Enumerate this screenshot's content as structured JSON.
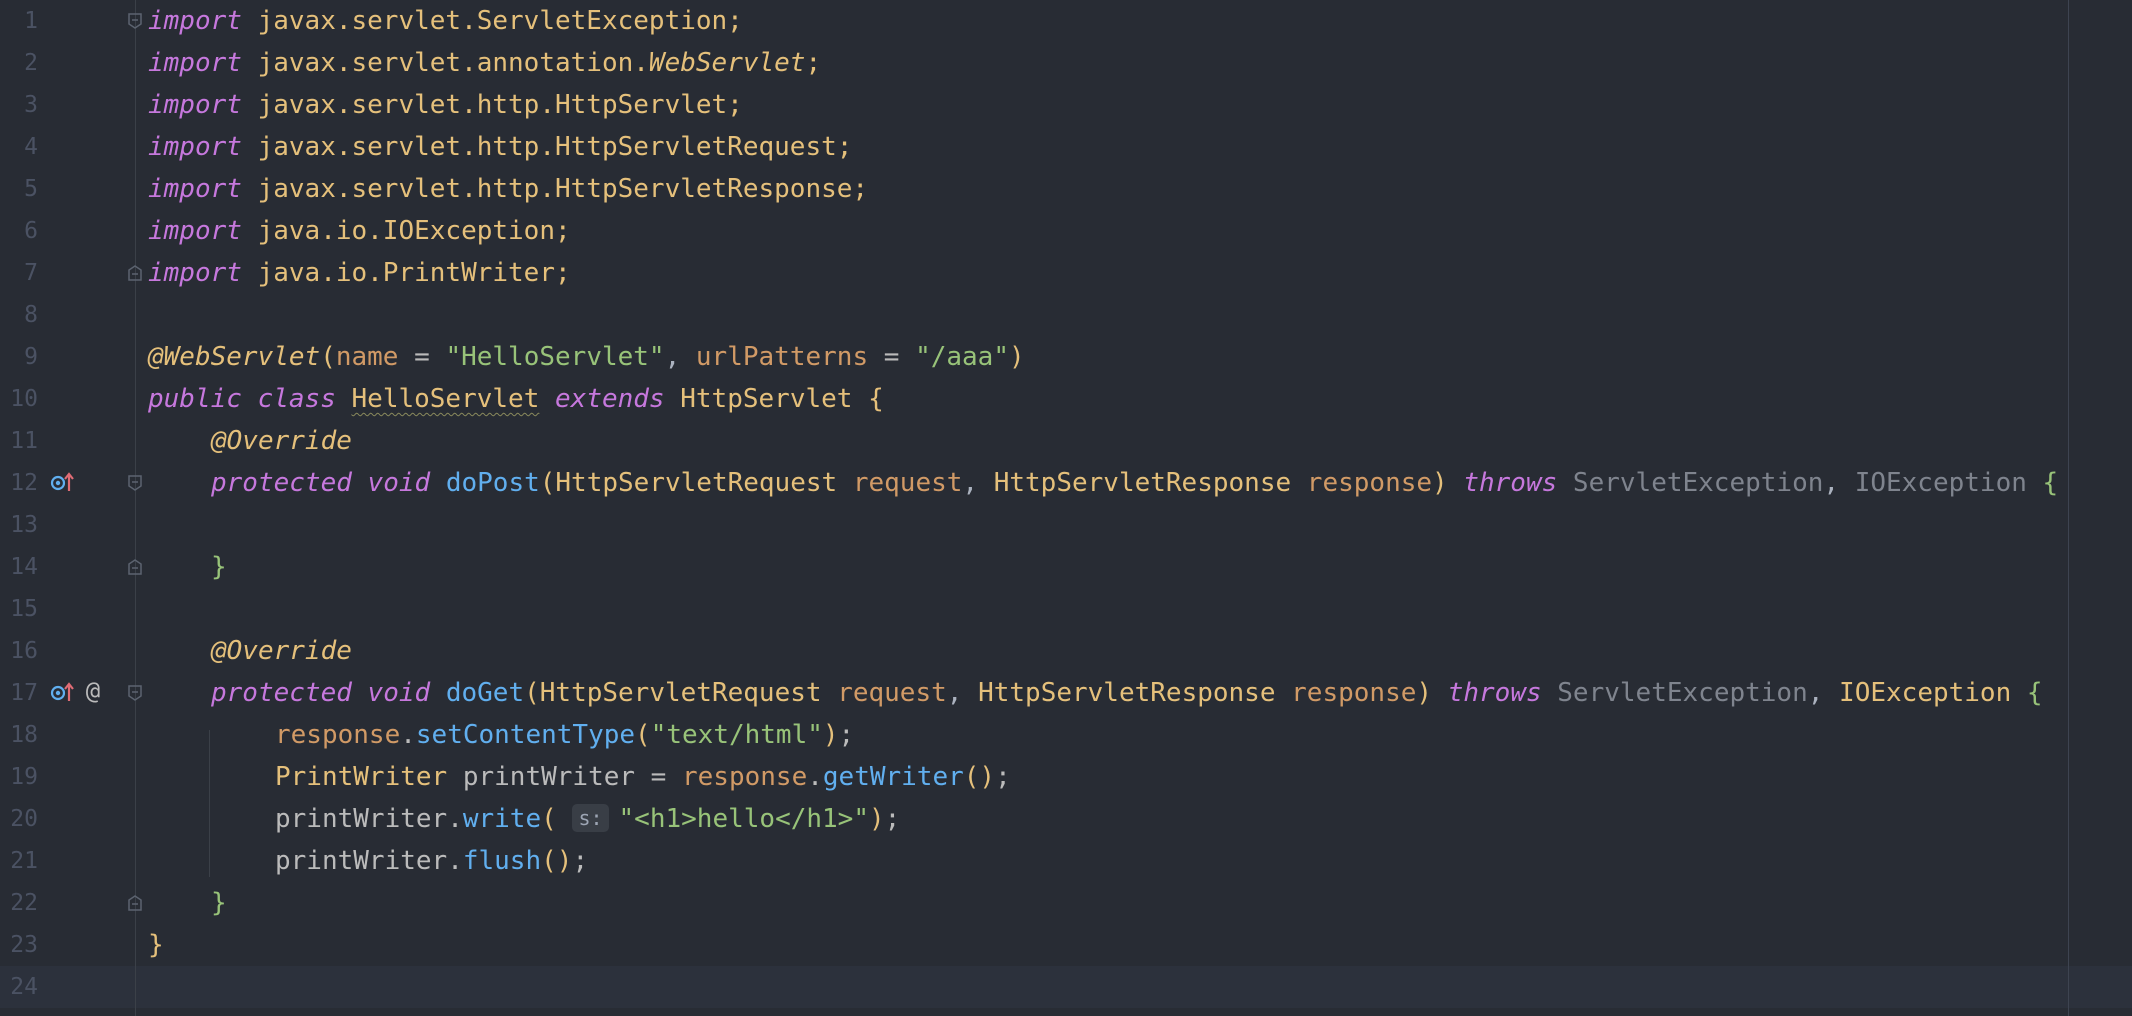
{
  "line_numbers": [
    "1",
    "2",
    "3",
    "4",
    "5",
    "6",
    "7",
    "8",
    "9",
    "10",
    "11",
    "12",
    "13",
    "14",
    "15",
    "16",
    "17",
    "18",
    "19",
    "20",
    "21",
    "22",
    "23",
    "24"
  ],
  "gutter": {
    "override_up_icon": "override-up-icon",
    "at_icon_label": "@",
    "fold_icon": "fold-icon"
  },
  "code": {
    "import_kw": "import",
    "imports": [
      "javax.servlet.ServletException;",
      "javax.servlet.annotation.",
      "javax.servlet.http.HttpServlet;",
      "javax.servlet.http.HttpServletRequest;",
      "javax.servlet.http.HttpServletResponse;",
      "java.io.IOException;",
      "java.io.PrintWriter;"
    ],
    "import2_class": "WebServlet",
    "import2_semi": ";",
    "annotation_name": "@WebServlet",
    "paren_open": "(",
    "paren_close": ")",
    "name_param": "name",
    "eq": " = ",
    "name_value": "\"HelloServlet\"",
    "comma_space": ", ",
    "url_param": "urlPatterns",
    "url_value": "\"/aaa\"",
    "public_kw": "public",
    "class_kw": "class",
    "class_name": "HelloServlet",
    "extends_kw": "extends",
    "superclass": "HttpServlet",
    "brace_open": "{",
    "brace_close": "}",
    "override": "@Override",
    "protected_kw": "protected",
    "void_kw": "void",
    "do_post": "doPost",
    "do_get": "doGet",
    "req_type": "HttpServletRequest",
    "req_name": "request",
    "resp_type": "HttpServletResponse",
    "resp_name": "response",
    "throws_kw": "throws",
    "servlet_exception": "ServletException",
    "io_exception": "IOException",
    "stmt1_obj": "response",
    "dot": ".",
    "stmt1_method": "setContentType",
    "stmt1_arg": "\"text/html\"",
    "semi": ";",
    "stmt2_type": "PrintWriter",
    "stmt2_var": "printWriter",
    "stmt2_eq": " = ",
    "stmt2_obj": "response",
    "stmt2_method": "getWriter",
    "empty_parens": "()",
    "stmt3_obj": "printWriter",
    "stmt3_method": "write",
    "param_hint": "s:",
    "stmt3_arg": "\"<h1>hello</h1>\"",
    "stmt4_obj": "printWriter",
    "stmt4_method": "flush"
  },
  "colors": {
    "background": "#282c34",
    "keyword": "#c678dd",
    "class_name": "#e5c07b",
    "string": "#98c379",
    "method": "#61afef",
    "parameter": "#d19a66",
    "line_number": "#4b5263"
  }
}
